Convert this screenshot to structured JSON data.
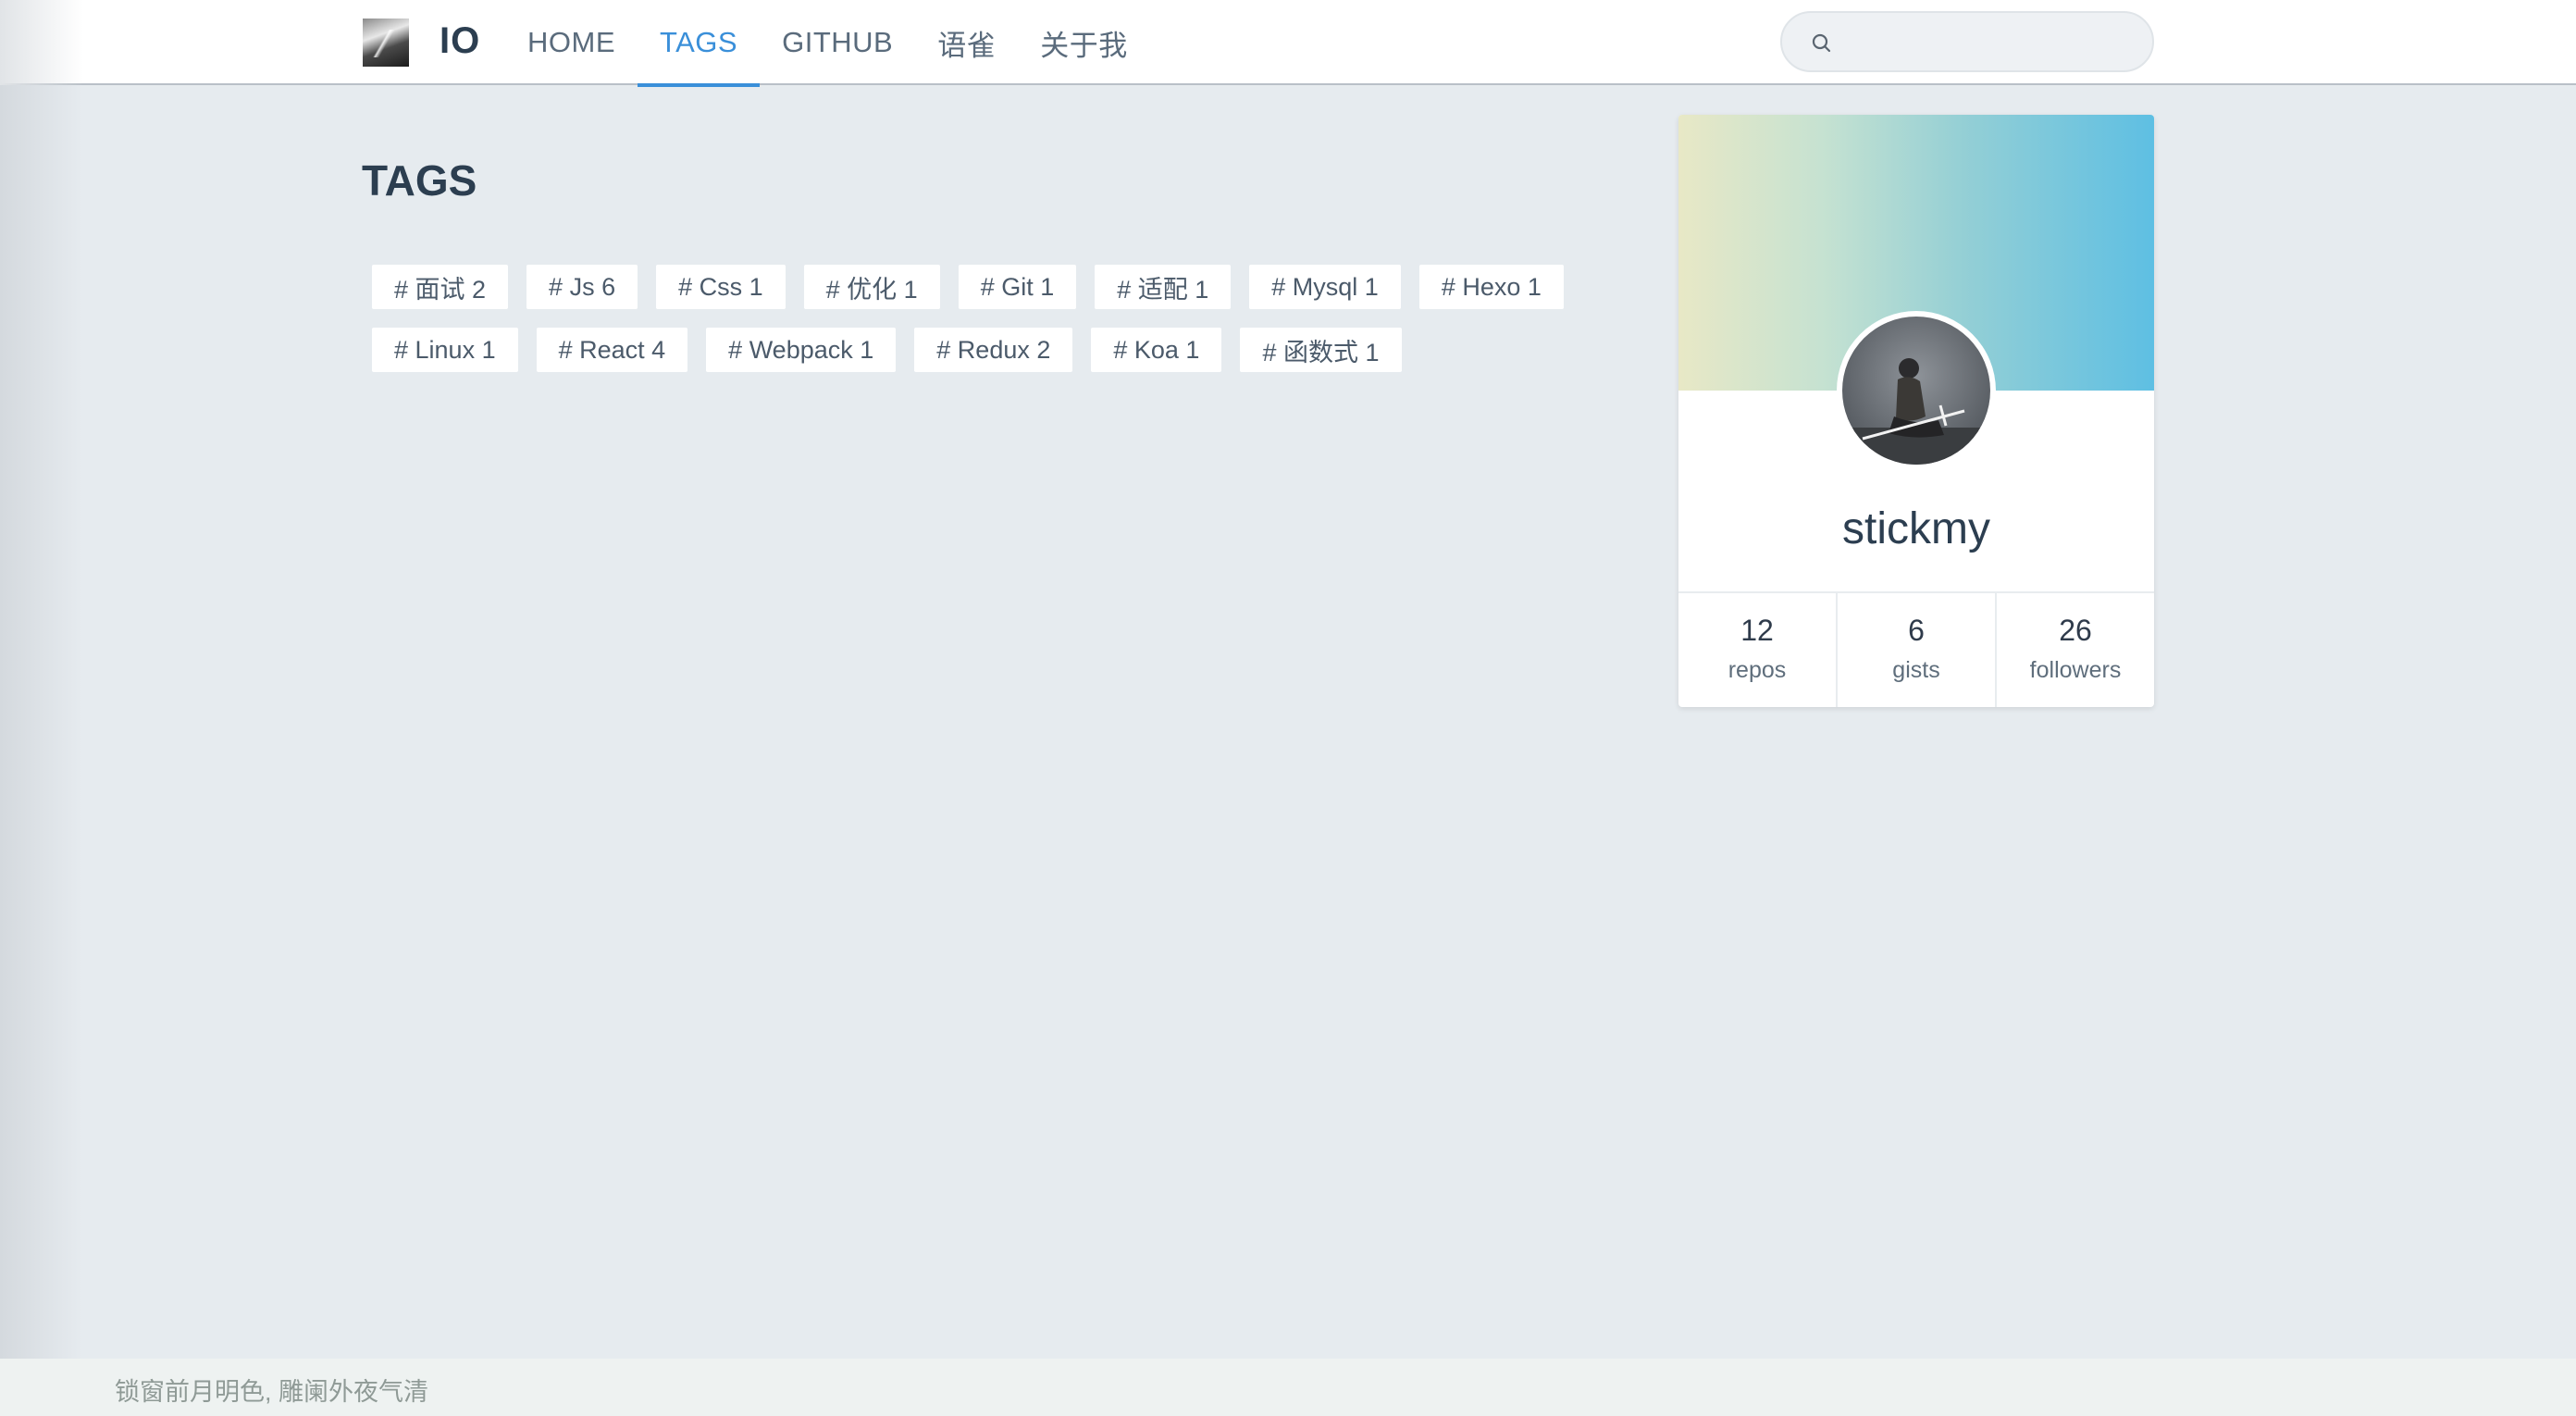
{
  "header": {
    "brand": "IO",
    "nav": [
      {
        "label": "HOME",
        "active": false
      },
      {
        "label": "TAGS",
        "active": true
      },
      {
        "label": "GITHUB",
        "active": false
      },
      {
        "label": "语雀",
        "active": false
      },
      {
        "label": "关于我",
        "active": false
      }
    ],
    "search": {
      "value": "",
      "placeholder": ""
    },
    "accent_color": "#3a8fd9"
  },
  "main": {
    "title": "TAGS",
    "tags": [
      "# 面试 2",
      "# Js 6",
      "# Css 1",
      "# 优化 1",
      "# Git 1",
      "# 适配 1",
      "# Mysql 1",
      "# Hexo 1",
      "# Linux 1",
      "# React 4",
      "# Webpack 1",
      "# Redux 2",
      "# Koa 1",
      "# 函数式 1"
    ]
  },
  "profile": {
    "username": "stickmy",
    "stats": [
      {
        "value": "12",
        "label": "repos"
      },
      {
        "value": "6",
        "label": "gists"
      },
      {
        "value": "26",
        "label": "followers"
      }
    ]
  },
  "footer": {
    "text": "锁窗前月明色, 雕阑外夜气清"
  }
}
